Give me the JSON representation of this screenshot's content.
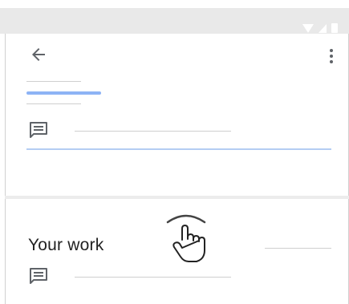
{
  "sheet": {
    "title": "Your work"
  },
  "icons": {
    "back": "arrow-back-icon",
    "more": "more-vert-icon",
    "comment": "comment-icon",
    "handle": "drag-handle-icon",
    "hand": "pointer-hand-icon"
  },
  "colors": {
    "accent": "#8db3f5",
    "status_bar": "#e9e9e9"
  }
}
